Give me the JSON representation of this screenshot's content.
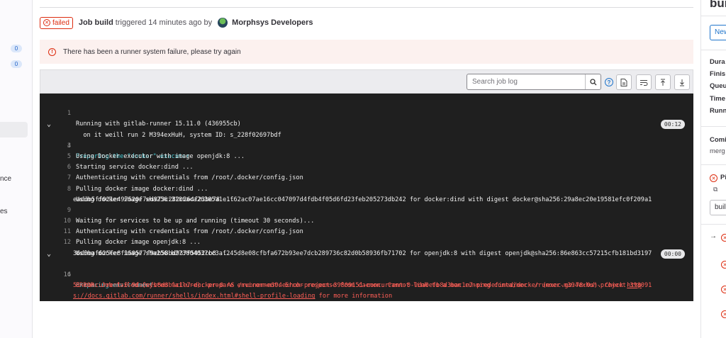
{
  "left_sidebar": {
    "badges": [
      "0",
      "0"
    ],
    "partial_labels": [
      "nce",
      "es"
    ]
  },
  "header": {
    "status": "failed",
    "job_label": "Job build",
    "triggered_text": "triggered 14 minutes ago by",
    "user": "Morphsys Developers"
  },
  "alert": {
    "message": "There has been a runner system failure, please try again"
  },
  "toolbar": {
    "search_placeholder": "Search job log"
  },
  "log": {
    "lines": [
      {
        "n": "1",
        "text": "Running with gitlab-runner 15.11.0 (436955cb)",
        "style": ""
      },
      {
        "n": "",
        "text": "  on it weill run 2 M394exHuH, system ID: s_228f02697bdf",
        "style": ""
      },
      {
        "n": "3",
        "text": "Preparing the \"docker\" executor",
        "style": "cyan",
        "section": true,
        "duration": "00:12"
      },
      {
        "n": "4",
        "text": "Using Docker executor with image openjdk:8 ...",
        "style": ""
      },
      {
        "n": "5",
        "text": "Starting service docker:dind ...",
        "style": ""
      },
      {
        "n": "6",
        "text": "Authenticating with credentials from /root/.docker/config.json",
        "style": ""
      },
      {
        "n": "7",
        "text": "Pulling docker image docker:dind ...",
        "style": ""
      },
      {
        "n": "8",
        "text": "Using docker image sha256:3186aca26385a1e1f62ac07ae16cc047097d4fdb4f05d6fd23feb205273db242 for docker:dind with digest docker@sha256:29a8ec20e19581efc0f209a1",
        "style": ""
      },
      {
        "n": "",
        "text": "eaddb5ff021e497520f7ed973c282c264f23be78 ...",
        "style": "",
        "cont": true
      },
      {
        "n": "9",
        "text": "Waiting for services to be up and running (timeout 30 seconds)...",
        "style": ""
      },
      {
        "n": "10",
        "text": "Authenticating with credentials from /root/.docker/config.json",
        "style": ""
      },
      {
        "n": "11",
        "text": "Pulling docker image openjdk:8 ...",
        "style": ""
      },
      {
        "n": "12",
        "text": "Using docker image sha256:b273004037cc3af245d8e08cfbfa672b93ee7dcb289736c82d0b58936fb71702 for openjdk:8 with digest openjdk@sha256:86e863cc57215cfb181bd3197",
        "style": ""
      },
      {
        "n": "",
        "text": "36d0baf625fe8f150577f9eb58bd937f5452cb8 ...",
        "style": "",
        "cont": true
      },
      {
        "n": "14",
        "text": "Preparing environment",
        "style": "cyan",
        "section": true,
        "duration": "00:00"
      },
      {
        "n": "16",
        "text": "ERROR: Job failed (system failure): prepare environment: Error response from daemon: Cannot link to a non running container: /runner-m394exhuh-project-398091",
        "style": "red"
      },
      {
        "n": "",
        "text": "51-concurrent-0-9da0efb8d3bac1e7-docker-0 AS /runner-m394exhuh-project-39809151-concurrent-0-9da0efb8d3bac1e7-predefined/docker (exec.go:78:0s). Check ",
        "style": "red",
        "cont": true,
        "link": "http"
      },
      {
        "n": "",
        "text": "s://docs.gitlab.com/runner/shells/index.html#shell-profile-loading",
        "style": "link",
        "cont": true,
        "suffix": " for more information"
      }
    ]
  },
  "right_sidebar": {
    "title": "bui",
    "new_button": "New",
    "labels": [
      "Dura",
      "Finis",
      "Queu",
      "Time",
      "Runn"
    ],
    "commit_label": "Comi",
    "commit_text": "merg",
    "pipeline_label": "Pi",
    "stage_value": "buil"
  },
  "colors": {
    "failed": "#dd2b0e",
    "log_bg": "#1f1f1f",
    "section": "#42c9d4",
    "error": "#ff5f57"
  }
}
